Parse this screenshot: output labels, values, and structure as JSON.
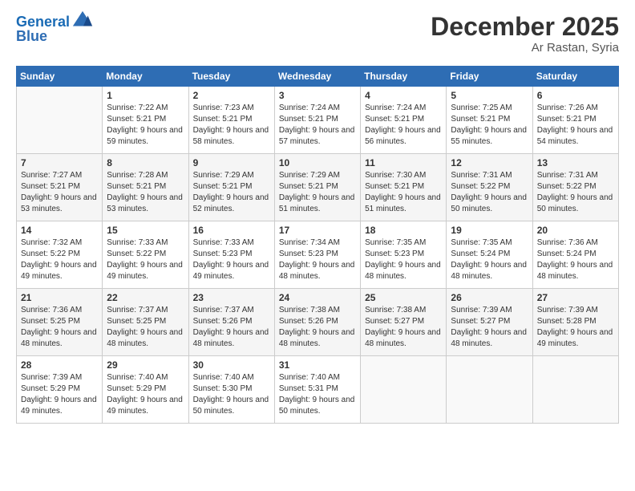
{
  "header": {
    "logo_line1": "General",
    "logo_line2": "Blue",
    "month": "December 2025",
    "location": "Ar Rastan, Syria"
  },
  "weekdays": [
    "Sunday",
    "Monday",
    "Tuesday",
    "Wednesday",
    "Thursday",
    "Friday",
    "Saturday"
  ],
  "weeks": [
    [
      {
        "day": "",
        "sunrise": "",
        "sunset": "",
        "daylight": ""
      },
      {
        "day": "1",
        "sunrise": "Sunrise: 7:22 AM",
        "sunset": "Sunset: 5:21 PM",
        "daylight": "Daylight: 9 hours and 59 minutes."
      },
      {
        "day": "2",
        "sunrise": "Sunrise: 7:23 AM",
        "sunset": "Sunset: 5:21 PM",
        "daylight": "Daylight: 9 hours and 58 minutes."
      },
      {
        "day": "3",
        "sunrise": "Sunrise: 7:24 AM",
        "sunset": "Sunset: 5:21 PM",
        "daylight": "Daylight: 9 hours and 57 minutes."
      },
      {
        "day": "4",
        "sunrise": "Sunrise: 7:24 AM",
        "sunset": "Sunset: 5:21 PM",
        "daylight": "Daylight: 9 hours and 56 minutes."
      },
      {
        "day": "5",
        "sunrise": "Sunrise: 7:25 AM",
        "sunset": "Sunset: 5:21 PM",
        "daylight": "Daylight: 9 hours and 55 minutes."
      },
      {
        "day": "6",
        "sunrise": "Sunrise: 7:26 AM",
        "sunset": "Sunset: 5:21 PM",
        "daylight": "Daylight: 9 hours and 54 minutes."
      }
    ],
    [
      {
        "day": "7",
        "sunrise": "Sunrise: 7:27 AM",
        "sunset": "Sunset: 5:21 PM",
        "daylight": "Daylight: 9 hours and 53 minutes."
      },
      {
        "day": "8",
        "sunrise": "Sunrise: 7:28 AM",
        "sunset": "Sunset: 5:21 PM",
        "daylight": "Daylight: 9 hours and 53 minutes."
      },
      {
        "day": "9",
        "sunrise": "Sunrise: 7:29 AM",
        "sunset": "Sunset: 5:21 PM",
        "daylight": "Daylight: 9 hours and 52 minutes."
      },
      {
        "day": "10",
        "sunrise": "Sunrise: 7:29 AM",
        "sunset": "Sunset: 5:21 PM",
        "daylight": "Daylight: 9 hours and 51 minutes."
      },
      {
        "day": "11",
        "sunrise": "Sunrise: 7:30 AM",
        "sunset": "Sunset: 5:21 PM",
        "daylight": "Daylight: 9 hours and 51 minutes."
      },
      {
        "day": "12",
        "sunrise": "Sunrise: 7:31 AM",
        "sunset": "Sunset: 5:22 PM",
        "daylight": "Daylight: 9 hours and 50 minutes."
      },
      {
        "day": "13",
        "sunrise": "Sunrise: 7:31 AM",
        "sunset": "Sunset: 5:22 PM",
        "daylight": "Daylight: 9 hours and 50 minutes."
      }
    ],
    [
      {
        "day": "14",
        "sunrise": "Sunrise: 7:32 AM",
        "sunset": "Sunset: 5:22 PM",
        "daylight": "Daylight: 9 hours and 49 minutes."
      },
      {
        "day": "15",
        "sunrise": "Sunrise: 7:33 AM",
        "sunset": "Sunset: 5:22 PM",
        "daylight": "Daylight: 9 hours and 49 minutes."
      },
      {
        "day": "16",
        "sunrise": "Sunrise: 7:33 AM",
        "sunset": "Sunset: 5:23 PM",
        "daylight": "Daylight: 9 hours and 49 minutes."
      },
      {
        "day": "17",
        "sunrise": "Sunrise: 7:34 AM",
        "sunset": "Sunset: 5:23 PM",
        "daylight": "Daylight: 9 hours and 48 minutes."
      },
      {
        "day": "18",
        "sunrise": "Sunrise: 7:35 AM",
        "sunset": "Sunset: 5:23 PM",
        "daylight": "Daylight: 9 hours and 48 minutes."
      },
      {
        "day": "19",
        "sunrise": "Sunrise: 7:35 AM",
        "sunset": "Sunset: 5:24 PM",
        "daylight": "Daylight: 9 hours and 48 minutes."
      },
      {
        "day": "20",
        "sunrise": "Sunrise: 7:36 AM",
        "sunset": "Sunset: 5:24 PM",
        "daylight": "Daylight: 9 hours and 48 minutes."
      }
    ],
    [
      {
        "day": "21",
        "sunrise": "Sunrise: 7:36 AM",
        "sunset": "Sunset: 5:25 PM",
        "daylight": "Daylight: 9 hours and 48 minutes."
      },
      {
        "day": "22",
        "sunrise": "Sunrise: 7:37 AM",
        "sunset": "Sunset: 5:25 PM",
        "daylight": "Daylight: 9 hours and 48 minutes."
      },
      {
        "day": "23",
        "sunrise": "Sunrise: 7:37 AM",
        "sunset": "Sunset: 5:26 PM",
        "daylight": "Daylight: 9 hours and 48 minutes."
      },
      {
        "day": "24",
        "sunrise": "Sunrise: 7:38 AM",
        "sunset": "Sunset: 5:26 PM",
        "daylight": "Daylight: 9 hours and 48 minutes."
      },
      {
        "day": "25",
        "sunrise": "Sunrise: 7:38 AM",
        "sunset": "Sunset: 5:27 PM",
        "daylight": "Daylight: 9 hours and 48 minutes."
      },
      {
        "day": "26",
        "sunrise": "Sunrise: 7:39 AM",
        "sunset": "Sunset: 5:27 PM",
        "daylight": "Daylight: 9 hours and 48 minutes."
      },
      {
        "day": "27",
        "sunrise": "Sunrise: 7:39 AM",
        "sunset": "Sunset: 5:28 PM",
        "daylight": "Daylight: 9 hours and 49 minutes."
      }
    ],
    [
      {
        "day": "28",
        "sunrise": "Sunrise: 7:39 AM",
        "sunset": "Sunset: 5:29 PM",
        "daylight": "Daylight: 9 hours and 49 minutes."
      },
      {
        "day": "29",
        "sunrise": "Sunrise: 7:40 AM",
        "sunset": "Sunset: 5:29 PM",
        "daylight": "Daylight: 9 hours and 49 minutes."
      },
      {
        "day": "30",
        "sunrise": "Sunrise: 7:40 AM",
        "sunset": "Sunset: 5:30 PM",
        "daylight": "Daylight: 9 hours and 50 minutes."
      },
      {
        "day": "31",
        "sunrise": "Sunrise: 7:40 AM",
        "sunset": "Sunset: 5:31 PM",
        "daylight": "Daylight: 9 hours and 50 minutes."
      },
      {
        "day": "",
        "sunrise": "",
        "sunset": "",
        "daylight": ""
      },
      {
        "day": "",
        "sunrise": "",
        "sunset": "",
        "daylight": ""
      },
      {
        "day": "",
        "sunrise": "",
        "sunset": "",
        "daylight": ""
      }
    ]
  ]
}
